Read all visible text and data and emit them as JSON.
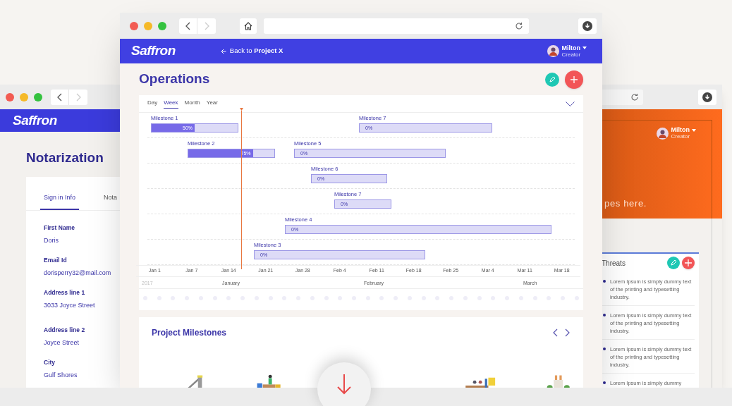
{
  "left_window": {
    "logo": "Saffron",
    "title": "Notarization",
    "tabs": [
      {
        "label": "Sign in Info",
        "selected": true
      },
      {
        "label": "Nota",
        "selected": false
      }
    ],
    "fields": [
      {
        "label": "First Name",
        "value": "Doris"
      },
      {
        "label": "Email Id",
        "value": "dorisperry32@mail.com"
      },
      {
        "label": "Address line 1",
        "value": "3033 Joyce Street"
      },
      {
        "label": "Address line 2",
        "value": "Joyce Street"
      },
      {
        "label": "City",
        "value": "Gulf Shores"
      }
    ]
  },
  "main_window": {
    "logo": "Saffron",
    "back_link": "Back to **Project X**",
    "user": {
      "name": "Milton",
      "role": "Creator"
    },
    "title": "Operations",
    "gantt": {
      "scales": [
        {
          "label": "Day",
          "selected": false
        },
        {
          "label": "Week",
          "selected": true
        },
        {
          "label": "Month",
          "selected": false
        },
        {
          "label": "Year",
          "selected": false
        }
      ],
      "rows": [
        {
          "bars": [
            {
              "name": "Milestone 1",
              "progress": "50%",
              "level": 0.5
            },
            {
              "name": "Milestone 7",
              "progress": "0%"
            }
          ]
        },
        {
          "bars": [
            {
              "name": "Milestone 2",
              "progress": "75%",
              "level": 0.75
            },
            {
              "name": "Milestone 5",
              "progress": "0%"
            }
          ]
        },
        {
          "bars": [
            {
              "name": "Milestone 6",
              "progress": "0%"
            }
          ]
        },
        {
          "bars": [
            {
              "name": "Milestone 7",
              "progress": "0%"
            }
          ]
        },
        {
          "bars": [
            {
              "name": "Milestone 4",
              "progress": "0%"
            }
          ]
        },
        {
          "bars": [
            {
              "name": "Milestone 3",
              "progress": "0%"
            }
          ]
        }
      ],
      "dates": [
        "Jan 1",
        "Jan 7",
        "Jan 14",
        "Jan 21",
        "Jan 28",
        "Feb 4",
        "Feb 11",
        "Feb 18",
        "Feb 25",
        "Mar 4",
        "Mar 11",
        "Mar 18"
      ],
      "year": "2017",
      "months": [
        "January",
        "February",
        "March"
      ]
    },
    "milestones_section": {
      "title": "Project Milestones"
    }
  },
  "right_window": {
    "user": {
      "name": "Milton",
      "role": "Creator"
    },
    "banner_text": "pes here.",
    "threats": {
      "title": "Threats",
      "items": [
        "Lorem Ipsum is simply dummy text of the printing and typesetting industry.",
        "Lorem Ipsum is simply dummy text of the printing and typesetting industry.",
        "Lorem Ipsum is simply dummy text of the printing and typesetting industry.",
        "Lorem Ipsum is simply dummy"
      ]
    }
  }
}
